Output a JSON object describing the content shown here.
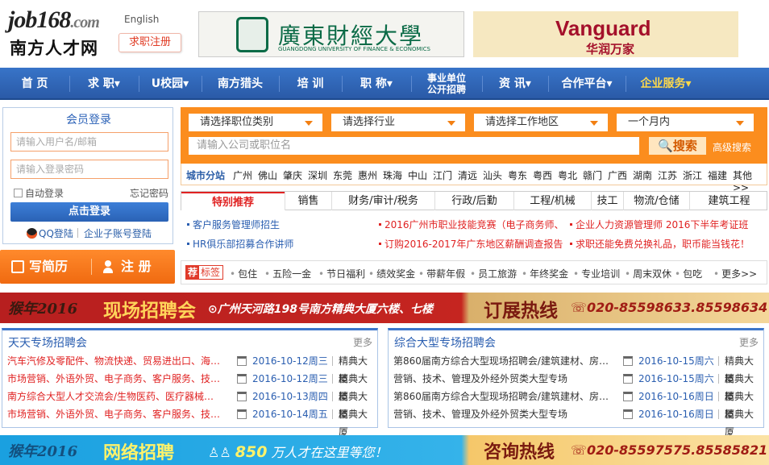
{
  "header": {
    "logo_main": "job168",
    "logo_tld": ".com",
    "logo_cn": "南方人才网",
    "lang": "English",
    "register": "求职注册",
    "ad1_title": "廣東財經大學",
    "ad1_sub": "GUANGDONG UNIVERSITY OF FINANCE & ECONOMICS",
    "ad2_title": "Vanguard",
    "ad2_sub": "华润万家"
  },
  "nav": [
    "首 页",
    "求 职▾",
    "U校园▾",
    "南方猎头",
    "培 训",
    "职 称▾",
    "事业单位\n公开招聘",
    "资 讯▾",
    "合作平台▾",
    "企业服务▾"
  ],
  "login": {
    "title": "会员登录",
    "user_ph": "请输入用户名/邮箱",
    "pass_ph": "请输入登录密码",
    "auto": "自动登录",
    "forget": "忘记密码",
    "button": "点击登录",
    "qq": "QQ登陆",
    "sub": "企业子账号登陆"
  },
  "resume": {
    "write": "写简历",
    "register": "注 册"
  },
  "search": {
    "sel1": "请选择职位类别",
    "sel2": "请选择行业",
    "sel3": "请选择工作地区",
    "sel4": "一个月内",
    "keyword_ph": "请输入公司或职位名",
    "button": "搜索",
    "advanced": "高级搜索"
  },
  "cities": {
    "label": "城市分站",
    "items": [
      "广州",
      "佛山",
      "肇庆",
      "深圳",
      "东莞",
      "惠州",
      "珠海",
      "中山",
      "江门",
      "清远",
      "汕头",
      "粤东",
      "粤西",
      "粤北",
      "赣门",
      "广西",
      "湖南",
      "江苏",
      "浙江",
      "福建",
      "其他>>"
    ]
  },
  "tabs": [
    "特别推荐",
    "销售",
    "财务/审计/税务",
    "行政/后勤",
    "工程/机械",
    "技工",
    "物流/仓储",
    "建筑工程"
  ],
  "tab_list": [
    "客户服务管理师招生",
    "2016广州市职业技能竞赛（电子商务师、",
    "企业人力资源管理师 2016下半年考证班",
    "HR俱乐部招募合作讲师",
    "订购2016-2017年广东地区薪酬调查报告",
    "求职还能免费兑换礼品，职币能当钱花！"
  ],
  "tags": {
    "label_a": "荐",
    "label_b": "标签",
    "items": [
      "包住",
      "五险一金",
      "节日福利",
      "绩效奖金",
      "带薪年假",
      "员工旅游",
      "年终奖金",
      "专业培训",
      "周末双休",
      "包吃",
      "更多>>"
    ]
  },
  "banner1": {
    "logo": "猴年2016",
    "title": "现场招聘会",
    "addr": "⊙广州天河路198号南方精典大厦六楼、七楼",
    "title2": "订展热线",
    "tel": "☏020-85598633.85598634"
  },
  "banner2": {
    "logo": "猴年2016",
    "title": "网络招聘",
    "people_a": "♙♙ ",
    "people_num": "850",
    "people_b": " 万人才在这里等您！",
    "title2": "咨询热线",
    "tel": "☏020-85597575.85585821"
  },
  "fair_left": {
    "title": "天天专场招聘会",
    "more": "更多",
    "rows": [
      {
        "t": "汽车汽修及零配件、物流快递、贸易进出口、海…",
        "d": "2016-10-12周三",
        "v": "精典大厦"
      },
      {
        "t": "市场营销、外语外贸、电子商务、客户服务、技…",
        "d": "2016-10-12周三",
        "v": "精典大厦"
      },
      {
        "t": "南方综合大型人才交流会/生物医药、医疗器械…",
        "d": "2016-10-13周四",
        "v": "精典大厦"
      },
      {
        "t": "市场营销、外语外贸、电子商务、客户服务、技…",
        "d": "2016-10-14周五",
        "v": "精典大厦"
      }
    ]
  },
  "fair_right": {
    "title": "综合大型专场招聘会",
    "more": "更多",
    "rows": [
      {
        "t": "第860届南方综合大型现场招聘会/建筑建材、房…",
        "d": "2016-10-15周六",
        "v": "精典大厦"
      },
      {
        "t": "营销、技术、管理及外经外贸类大型专场",
        "d": "2016-10-15周六",
        "v": "精典大厦"
      },
      {
        "t": "第860届南方综合大型现场招聘会/建筑建材、房…",
        "d": "2016-10-16周日",
        "v": "精典大厦"
      },
      {
        "t": "营销、技术、管理及外经外贸类大型专场",
        "d": "2016-10-16周日",
        "v": "精典大厦"
      }
    ]
  },
  "colors": {
    "nav": "#2f63b3",
    "accent": "#fb8d1e",
    "red": "#e02222",
    "blue_text": "#2a5eb0"
  }
}
